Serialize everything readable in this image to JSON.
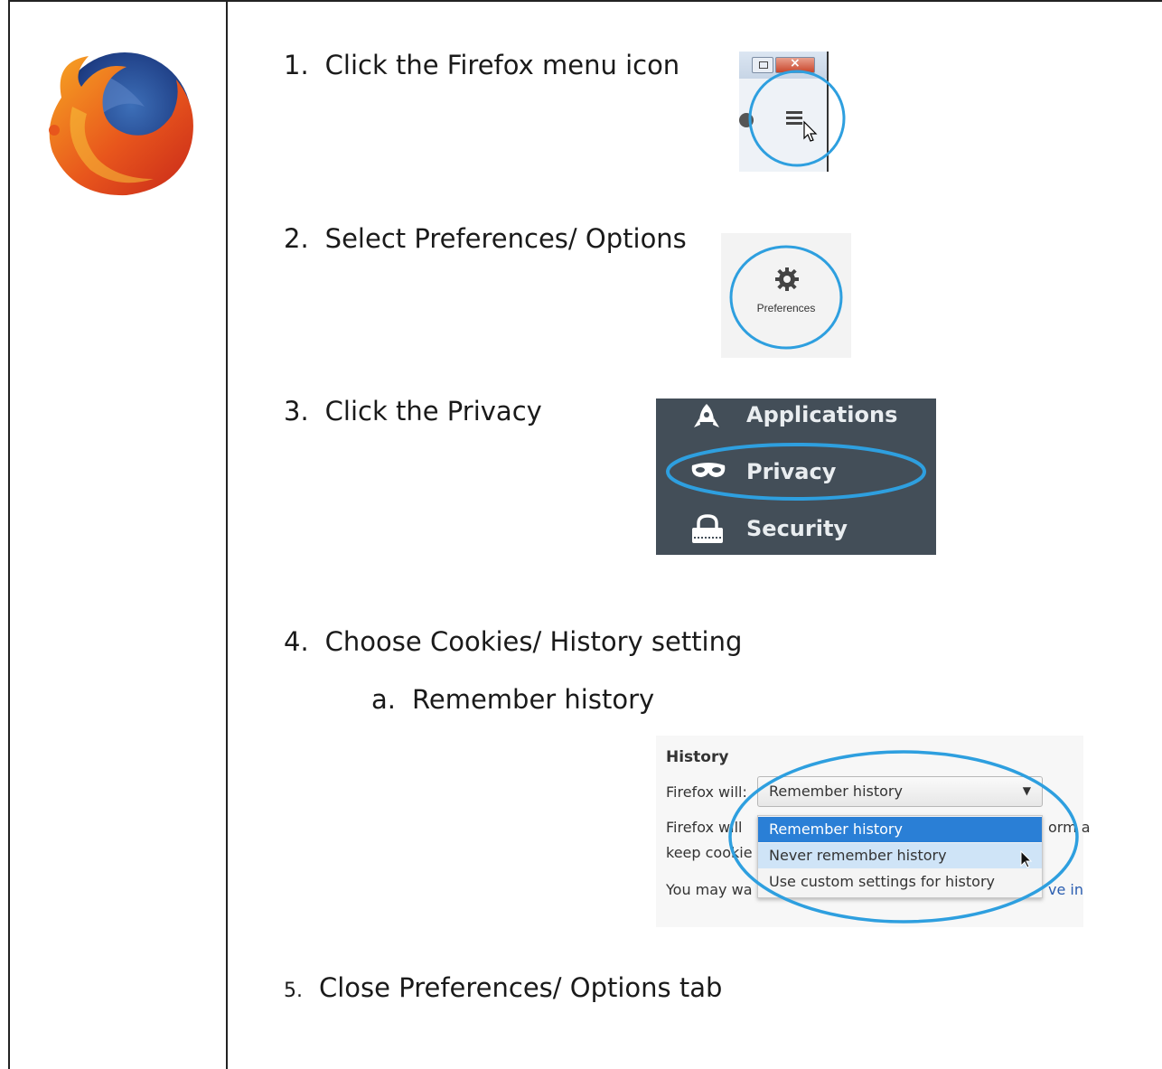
{
  "steps": [
    {
      "num": "1.",
      "text": "Click the Firefox menu icon"
    },
    {
      "num": "2.",
      "text": "Select Preferences/ Options"
    },
    {
      "num": "3.",
      "text": "Click the Privacy"
    },
    {
      "num": "4.",
      "text": "Choose Cookies/ History setting"
    },
    {
      "num": "a.",
      "text": "Remember history"
    },
    {
      "num": "5.",
      "text": "Close Preferences/ Options tab"
    }
  ],
  "logo": {
    "icon": "firefox-logo"
  },
  "step2_image": {
    "label": "Preferences",
    "icon": "gear-icon"
  },
  "step3_image": {
    "items": [
      {
        "label": "Applications",
        "icon": "rocket-icon"
      },
      {
        "label": "Privacy",
        "icon": "mask-icon"
      },
      {
        "label": "Security",
        "icon": "lock-icon"
      }
    ]
  },
  "step4_image": {
    "heading": "History",
    "firefox_will": "Firefox will:",
    "selected": "Remember history",
    "options": [
      "Remember history",
      "Never remember history",
      "Use custom settings for history"
    ],
    "bg_line1_left": "Firefox will",
    "bg_line1_right": "orm a",
    "bg_line2_left": "keep cookie",
    "bg_line3_left": "You may wa",
    "bg_line3_right": "ve in"
  },
  "colors": {
    "highlight_circle": "#2e9fdf",
    "menu_selected": "#2a7fd6",
    "nav_bg": "#434e58"
  }
}
